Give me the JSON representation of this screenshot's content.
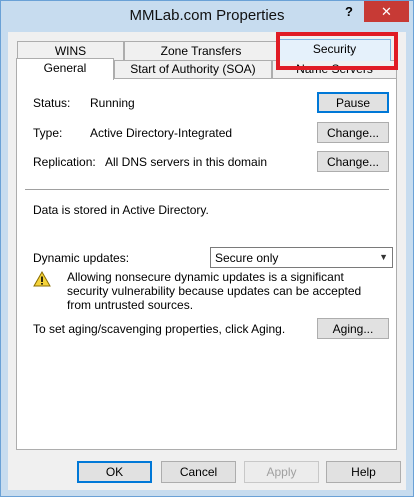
{
  "window": {
    "title": "MMLab.com Properties",
    "help_glyph": "?",
    "close_glyph": "✕"
  },
  "tabs": {
    "back_row": [
      "WINS",
      "Zone Transfers",
      "Security"
    ],
    "front_row": [
      "General",
      "Start of Authority (SOA)",
      "Name Servers"
    ],
    "active": "General",
    "highlighted": "Security"
  },
  "general": {
    "status_label": "Status:",
    "status_value": "Running",
    "pause_button": "Pause",
    "type_label": "Type:",
    "type_value": "Active Directory-Integrated",
    "type_change_button": "Change...",
    "replication_label": "Replication:",
    "replication_value": "All DNS servers in this domain",
    "replication_change_button": "Change...",
    "storage_text": "Data is stored in Active Directory.",
    "dynamic_updates_label": "Dynamic updates:",
    "dynamic_updates_value": "Secure only",
    "warning_text": "Allowing nonsecure dynamic updates is a significant security vulnerability because updates can be accepted from untrusted sources.",
    "aging_text": "To set aging/scavenging properties, click Aging.",
    "aging_button": "Aging..."
  },
  "footer": {
    "ok": "OK",
    "cancel": "Cancel",
    "apply": "Apply",
    "help": "Help"
  },
  "colors": {
    "highlight": "#e01b24",
    "close_button": "#c73a35",
    "title_bar": "#c7dcef"
  },
  "icons": {
    "warning": "warning-icon",
    "dropdown": "chevron-down-icon"
  }
}
